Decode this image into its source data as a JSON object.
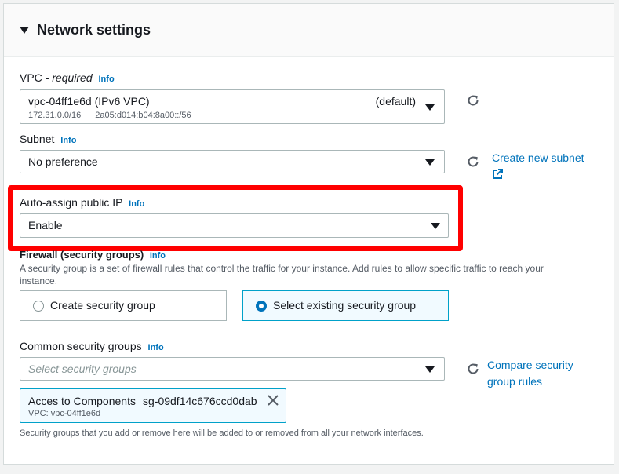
{
  "section": {
    "title": "Network settings"
  },
  "vpc": {
    "label": "VPC",
    "required": "- required",
    "info": "Info",
    "value": "vpc-04ff1e6d (IPv6 VPC)",
    "default_tag": "(default)",
    "ipv4_cidr": "172.31.0.0/16",
    "ipv6_cidr": "2a05:d014:b04:8a00::/56"
  },
  "subnet": {
    "label": "Subnet",
    "info": "Info",
    "value": "No preference",
    "create_link_label": "Create new subnet"
  },
  "auto_assign_ip": {
    "label": "Auto-assign public IP",
    "info": "Info",
    "value": "Enable"
  },
  "firewall": {
    "label": "Firewall (security groups)",
    "info": "Info",
    "description_line1": "A security group is a set of firewall rules that control the traffic for your instance. Add rules to allow specific traffic to reach your",
    "description_line2": "instance.",
    "options": [
      {
        "label": "Create security group",
        "selected": false
      },
      {
        "label": "Select existing security group",
        "selected": true
      }
    ]
  },
  "common_sg": {
    "label": "Common security groups",
    "info": "Info",
    "placeholder": "Select security groups",
    "compare_link_line1": "Compare security",
    "compare_link_line2": "group rules",
    "selected_token": {
      "name": "Acces to Components",
      "id": "sg-09df14c676ccd0dab",
      "vpc": "VPC: vpc-04ff1e6d"
    },
    "footnote": "Security groups that you add or remove here will be added to or removed from all your network interfaces."
  },
  "colors": {
    "link": "#0073bb",
    "highlight_box": "#ff0000",
    "selected_tile_bg": "#f1faff"
  }
}
